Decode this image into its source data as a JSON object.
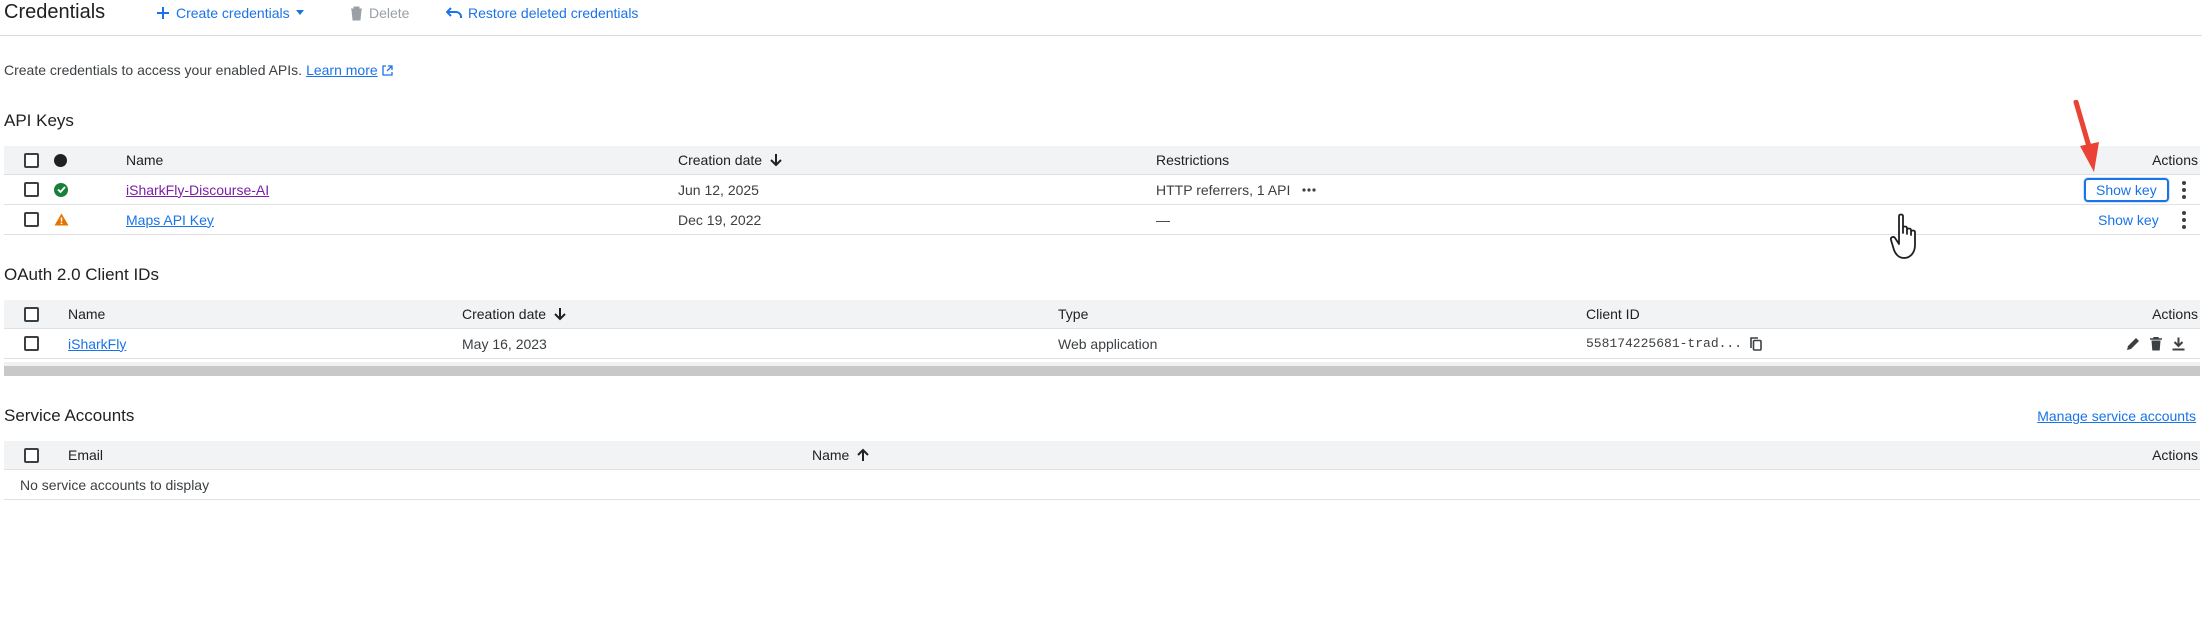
{
  "header": {
    "title": "Credentials",
    "create_label": "Create credentials",
    "delete_label": "Delete",
    "restore_label": "Restore deleted credentials"
  },
  "intro": {
    "text": "Create credentials to access your enabled APIs.",
    "learn_more": "Learn more"
  },
  "api_keys": {
    "title": "API Keys",
    "columns": {
      "name": "Name",
      "creation_date": "Creation date",
      "restrictions": "Restrictions",
      "actions": "Actions"
    },
    "rows": [
      {
        "name": "iSharkFly-Discourse-AI",
        "status": "ok",
        "creation_date": "Jun 12, 2025",
        "restrictions": "HTTP referrers, 1 API",
        "action": "Show key"
      },
      {
        "name": "Maps API Key",
        "status": "warning",
        "creation_date": "Dec 19, 2022",
        "restrictions": "—",
        "action": "Show key"
      }
    ]
  },
  "oauth": {
    "title": "OAuth 2.0 Client IDs",
    "columns": {
      "name": "Name",
      "creation_date": "Creation date",
      "type": "Type",
      "client_id": "Client ID",
      "actions": "Actions"
    },
    "rows": [
      {
        "name": "iSharkFly",
        "creation_date": "May 16, 2023",
        "type": "Web application",
        "client_id": "558174225681-trad..."
      }
    ]
  },
  "service_accounts": {
    "title": "Service Accounts",
    "manage_link": "Manage service accounts",
    "columns": {
      "email": "Email",
      "name": "Name",
      "actions": "Actions"
    },
    "empty_text": "No service accounts to display"
  },
  "colors": {
    "accent": "#1a73e8",
    "visited_link": "#7b1fa2",
    "ok": "#188038",
    "warning": "#e37400",
    "annotation_arrow": "#ea4335"
  }
}
